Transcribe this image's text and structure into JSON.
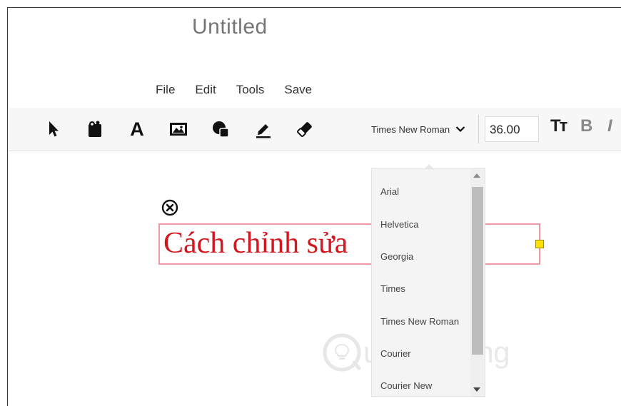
{
  "document": {
    "title": "Untitled"
  },
  "menu": {
    "items": [
      "File",
      "Edit",
      "Tools",
      "Save"
    ]
  },
  "toolbar": {
    "tools": [
      "select-tool",
      "sticker-tool",
      "text-tool",
      "image-tool",
      "shape-tool",
      "draw-tool",
      "eraser-tool"
    ],
    "text_tool_glyph": "A",
    "font_family": "Times New Roman",
    "font_size": "36.00",
    "text_size_glyph": "Tт",
    "bold_glyph": "B",
    "italic_glyph": "I"
  },
  "canvas": {
    "text_content": "Cách chỉnh sửa",
    "text_color": "#d4161f",
    "box_border_color": "#f09aa6",
    "handle_color": "#ffe100"
  },
  "font_dropdown": {
    "options": [
      "Arial",
      "Helvetica",
      "Georgia",
      "Times",
      "Times New Roman",
      "Courier",
      "Courier New"
    ]
  },
  "watermark": {
    "text": "uantrimang"
  }
}
